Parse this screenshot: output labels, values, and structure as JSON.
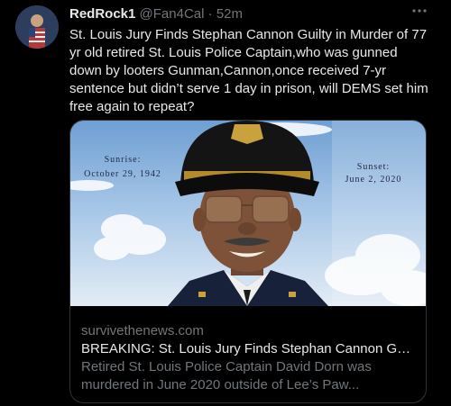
{
  "tweet": {
    "display_name": "RedRock1",
    "handle": "@Fan4Cal",
    "separator": "·",
    "time": "52m",
    "more_icon": "more-dots-icon",
    "text": "St. Louis Jury Finds Stephan Cannon Guilty in Murder of 77 yr old retired St. Louis Police Captain,who was gunned down by looters Gunman,Cannon,once received 7-yr sentence but didn’t serve  1  day in prison, will DEMS set him free again to repeat?"
  },
  "card": {
    "image": {
      "sunrise_label": "Sunrise:",
      "sunrise_date": "October 29, 1942",
      "sunset_label": "Sunset:",
      "sunset_date": "June 2, 2020"
    },
    "domain": "survivethenews.com",
    "title": "BREAKING: St. Louis Jury Finds Stephan Cannon Guilt...",
    "description": "Retired St. Louis Police Captain David Dorn was murdered in June 2020 outside of Lee’s Paw..."
  }
}
